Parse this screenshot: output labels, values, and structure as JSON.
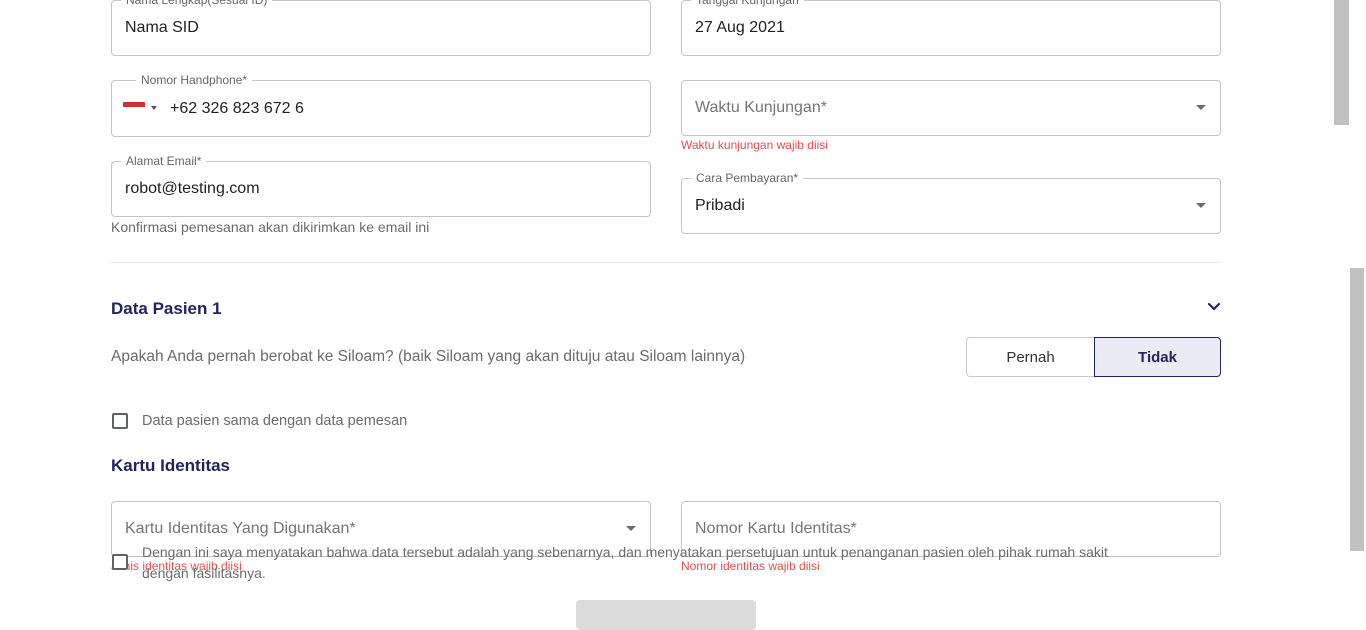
{
  "form": {
    "full_name": {
      "label": "Nama Lengkap(Sesuai ID)",
      "value": "Nama SID"
    },
    "visit_date": {
      "label": "Tanggal Kunjungan",
      "value": "27 Aug 2021"
    },
    "phone": {
      "label": "Nomor Handphone*",
      "value": "+62 326 823 672 6"
    },
    "visit_time": {
      "placeholder": "Waktu Kunjungan*",
      "error": "Waktu kunjungan wajib diisi"
    },
    "email": {
      "label": "Alamat Email*",
      "value": "robot@testing.com",
      "helper": "Konfirmasi pemesanan akan dikirimkan ke email ini"
    },
    "payment": {
      "label": "Cara Pembayaran*",
      "value": "Pribadi"
    }
  },
  "patient": {
    "title": "Data Pasien 1",
    "question": "Apakah Anda pernah berobat ke Siloam? (baik Siloam yang akan dituju atau Siloam lainnya)",
    "options": [
      "Pernah",
      "Tidak"
    ],
    "selected": "Tidak",
    "same_as_booker": "Data pasien sama dengan data pemesan"
  },
  "identity": {
    "title": "Kartu Identitas",
    "card_type": {
      "placeholder": "Kartu Identitas Yang Digunakan*",
      "error": "Jenis identitas wajib diisi"
    },
    "card_number": {
      "placeholder": "Nomor Kartu Identitas*",
      "error": "Nomor identitas wajib diisi"
    }
  },
  "consent": {
    "line1": "Dengan ini saya menyatakan bahwa data tersebut adalah yang sebenarnya, dan menyatakan persetujuan untuk penanganan pasien oleh pihak rumah sakit",
    "line2": "dengan fasilitasnya."
  },
  "colors": {
    "accent": "#23235e",
    "error": "#e05050",
    "selected_toggle_bg": "#ebebf5"
  }
}
